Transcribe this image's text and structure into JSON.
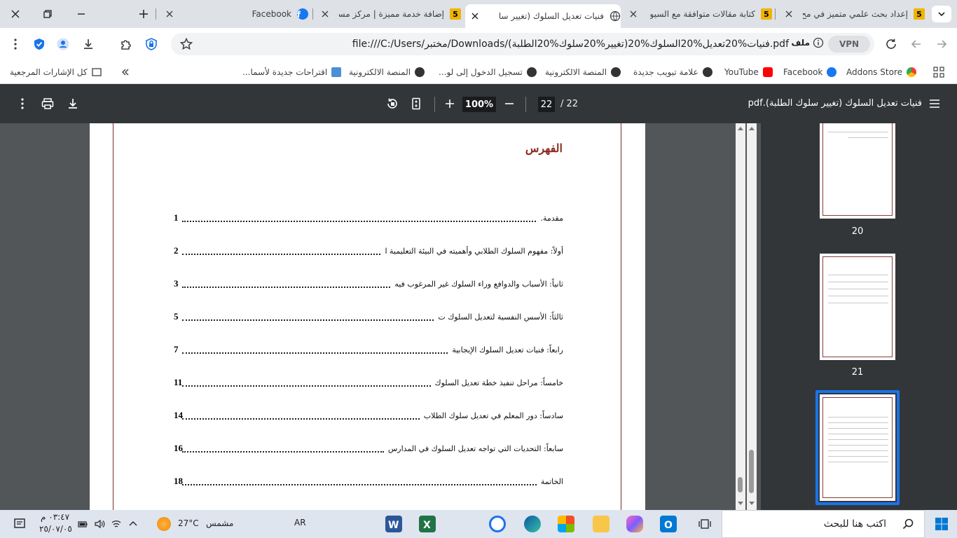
{
  "tabs": [
    {
      "title": "إعداد بحث علمي متميز في مح",
      "fav": "5"
    },
    {
      "title": "كتابة مقالات متوافقة مع السيو",
      "fav": "5"
    },
    {
      "title": "فنيات تعديل السلوك (تغيير سا",
      "fav": ""
    },
    {
      "title": "إضافة خدمة مميزة | مركز مسا",
      "fav": "5"
    },
    {
      "title": "Facebook",
      "fav": ""
    }
  ],
  "address": {
    "url": "file:///C:/Users/مختبر/Downloads/فنيات%20تعديل%20السلوك%20(تغيير%20سلوك%20الطلبة).pdf",
    "file_label": "ملف",
    "vpn": "VPN"
  },
  "bookmarks": [
    {
      "label": "Addons Store",
      "color": "#f4a300"
    },
    {
      "label": "Facebook",
      "color": "#1877f2"
    },
    {
      "label": "YouTube",
      "color": "#ff0000"
    },
    {
      "label": "علامة تبويب جديدة",
      "color": "#333333"
    },
    {
      "label": "المنصة الالكترونية",
      "color": "#333333"
    },
    {
      "label": "تسجيل الدخول إلى لو...",
      "color": "#333333"
    },
    {
      "label": "المنصة الالكترونية",
      "color": "#333333"
    },
    {
      "label": "اقتراحات جديدة لأسما...",
      "color": "#4a90d9"
    }
  ],
  "all_bookmarks": "كل الإشارات المرجعية",
  "pdf": {
    "title": "فنيات تعديل السلوك (تغيير سلوك الطلبة).pdf",
    "page_current": "22",
    "page_total": "/ 22",
    "zoom": "100%"
  },
  "toc": {
    "title": "الفهرس",
    "rows": [
      {
        "text": "مقدمة.",
        "page": "1"
      },
      {
        "text": "أولاً: مفهوم السلوك الطلابي وأهميته في البيئة التعليمية ا",
        "page": "2"
      },
      {
        "text": "ثانياً: الأسباب والدوافع وراء السلوك غير المرغوب فيه",
        "page": "3"
      },
      {
        "text": "ثالثاً: الأسس النفسية لتعديل السلوك ت",
        "page": "5"
      },
      {
        "text": "رابعاً: فنيات تعديل السلوك الإيجابية",
        "page": "7"
      },
      {
        "text": "خامساً: مراحل تنفيذ خطة تعديل السلوك",
        "page": "11"
      },
      {
        "text": "سادساً: دور المعلم في تعديل سلوك الطلاب",
        "page": "14"
      },
      {
        "text": "سابعاً: التحديات التي تواجه تعديل السلوك في المدارس",
        "page": "16"
      },
      {
        "text": "الخاتمة",
        "page": "18"
      }
    ]
  },
  "thumbnails": [
    {
      "label": "20"
    },
    {
      "label": "21"
    },
    {
      "label": ""
    }
  ],
  "taskbar": {
    "search_placeholder": "اكتب هنا للبحث",
    "lang": "AR",
    "weather_temp": "27°C",
    "weather_text": "مشمس",
    "time": "٠٣:٤٧ م",
    "date": "٢٥/٠٧/٠٥"
  }
}
